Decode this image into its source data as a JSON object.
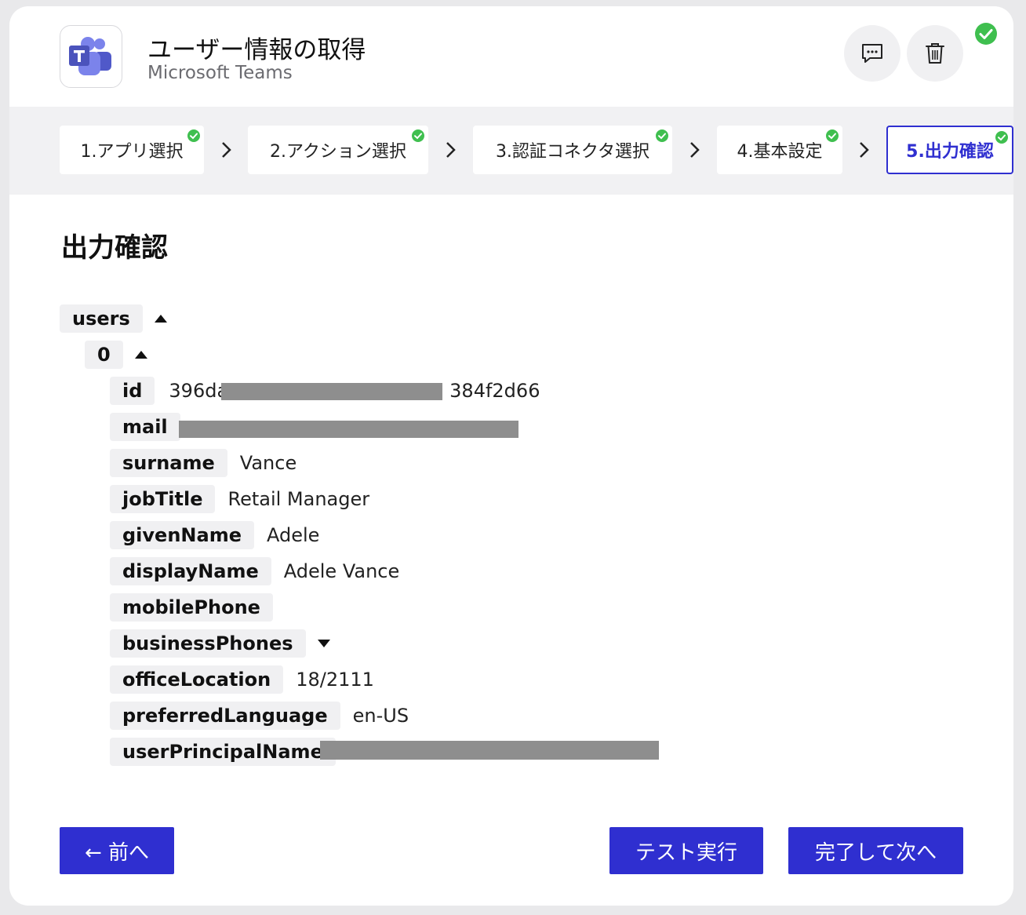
{
  "header": {
    "title": "ユーザー情報の取得",
    "subtitle": "Microsoft Teams"
  },
  "steps": [
    {
      "label": "1.アプリ選択",
      "completed": true,
      "active": false
    },
    {
      "label": "2.アクション選択",
      "completed": true,
      "active": false
    },
    {
      "label": "3.認証コネクタ選択",
      "completed": true,
      "active": false
    },
    {
      "label": "4.基本設定",
      "completed": true,
      "active": false
    },
    {
      "label": "5.出力確認",
      "completed": true,
      "active": true
    }
  ],
  "section": {
    "title": "出力確認"
  },
  "tree": {
    "root_key": "users",
    "index_key": "0",
    "fields": [
      {
        "key": "id",
        "value": "396da",
        "value_end": "384f2d66"
      },
      {
        "key": "mail",
        "value": ""
      },
      {
        "key": "surname",
        "value": "Vance"
      },
      {
        "key": "jobTitle",
        "value": "Retail Manager"
      },
      {
        "key": "givenName",
        "value": "Adele"
      },
      {
        "key": "displayName",
        "value": "Adele Vance"
      },
      {
        "key": "mobilePhone",
        "value": ""
      },
      {
        "key": "businessPhones",
        "value": ""
      },
      {
        "key": "officeLocation",
        "value": "18/2111"
      },
      {
        "key": "preferredLanguage",
        "value": "en-US"
      },
      {
        "key": "userPrincipalName",
        "value": ""
      }
    ]
  },
  "buttons": {
    "prev": "← 前へ",
    "test": "テスト実行",
    "next": "完了して次へ"
  },
  "colors": {
    "accent": "#2f2fd0",
    "success": "#3fbf4f",
    "key_bg": "#f0f0f2"
  }
}
